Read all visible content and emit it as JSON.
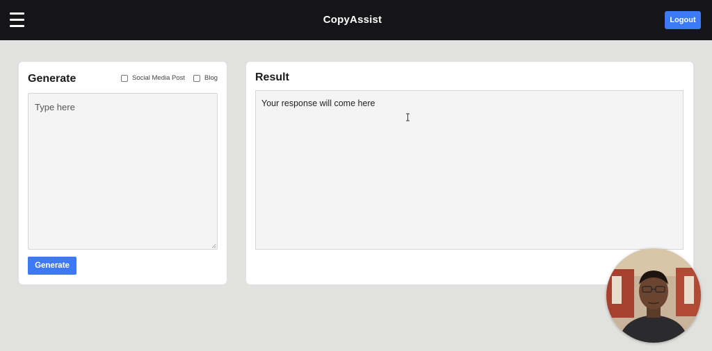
{
  "header": {
    "menu_icon": "hamburger-menu-icon",
    "title": "CopyAssist",
    "logout_label": "Logout",
    "accent_color": "#3d79f2",
    "background_color": "#151517"
  },
  "generate_panel": {
    "title": "Generate",
    "options": [
      {
        "label": "Social Media Post",
        "checked": false
      },
      {
        "label": "Blog",
        "checked": false
      }
    ],
    "input_placeholder": "Type here",
    "input_value": "",
    "button_label": "Generate"
  },
  "result_panel": {
    "title": "Result",
    "placeholder_text": "Your response will come here"
  },
  "overlay": {
    "webcam_icon": "presenter-webcam-avatar"
  }
}
